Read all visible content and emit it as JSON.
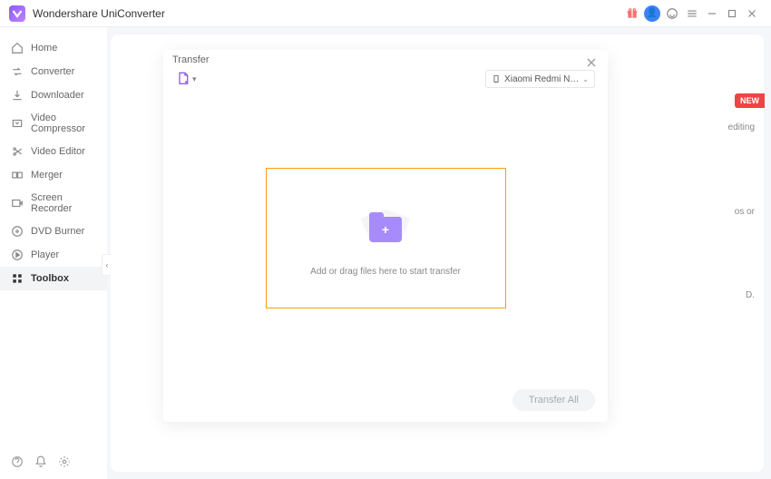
{
  "app": {
    "title": "Wondershare UniConverter"
  },
  "sidebar": {
    "items": [
      {
        "label": "Home"
      },
      {
        "label": "Converter"
      },
      {
        "label": "Downloader"
      },
      {
        "label": "Video Compressor"
      },
      {
        "label": "Video Editor"
      },
      {
        "label": "Merger"
      },
      {
        "label": "Screen Recorder"
      },
      {
        "label": "DVD Burner"
      },
      {
        "label": "Player"
      },
      {
        "label": "Toolbox"
      }
    ]
  },
  "badge": {
    "new": "NEW"
  },
  "snippets": {
    "a": "editing",
    "b": "os or",
    "c": "D."
  },
  "modal": {
    "title": "Transfer",
    "device": "Xiaomi Redmi N…",
    "drop_text": "Add or drag files here to start transfer",
    "transfer_all": "Transfer All"
  }
}
